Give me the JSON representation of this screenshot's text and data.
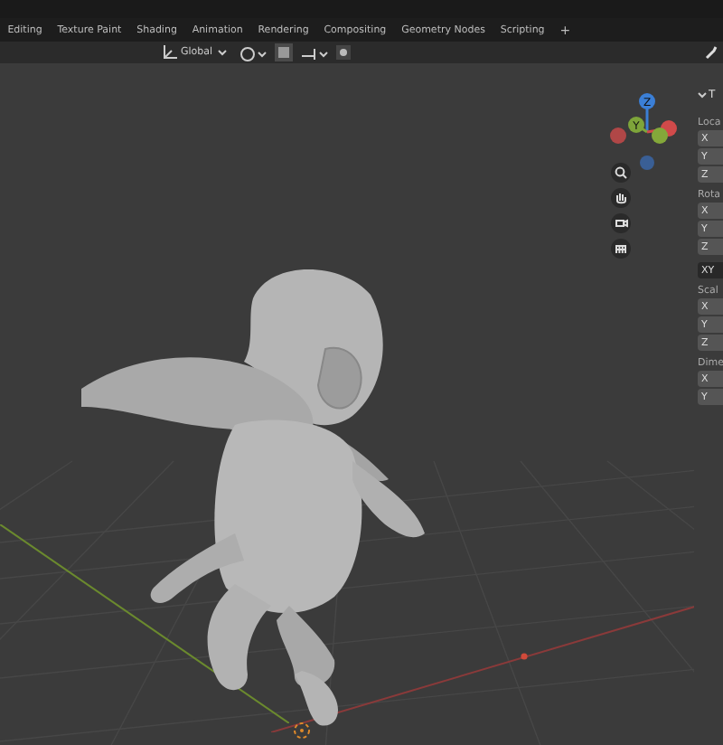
{
  "workspace_tabs": [
    {
      "label": "Editing",
      "selected": false
    },
    {
      "label": "Texture Paint",
      "selected": false
    },
    {
      "label": "Shading",
      "selected": false
    },
    {
      "label": "Animation",
      "selected": false
    },
    {
      "label": "Rendering",
      "selected": false
    },
    {
      "label": "Compositing",
      "selected": false
    },
    {
      "label": "Geometry Nodes",
      "selected": false
    },
    {
      "label": "Scripting",
      "selected": false
    }
  ],
  "add_tab": "+",
  "header": {
    "orientation": "Global",
    "snap_on": true
  },
  "gizmo": {
    "z_label": "Z",
    "y_label": "Y"
  },
  "sidebar": {
    "panel_title": "T",
    "rows": [
      {
        "kind": "label",
        "text": "Loca"
      },
      {
        "kind": "field",
        "text": "X"
      },
      {
        "kind": "field",
        "text": "Y"
      },
      {
        "kind": "field",
        "text": "Z"
      },
      {
        "kind": "label",
        "text": "Rota"
      },
      {
        "kind": "field",
        "text": "X"
      },
      {
        "kind": "field",
        "text": "Y"
      },
      {
        "kind": "field",
        "text": "Z"
      },
      {
        "kind": "dropdown",
        "text": "XY"
      },
      {
        "kind": "label",
        "text": "Scal"
      },
      {
        "kind": "field",
        "text": "X"
      },
      {
        "kind": "field",
        "text": "Y"
      },
      {
        "kind": "field",
        "text": "Z"
      },
      {
        "kind": "label",
        "text": "Dime"
      },
      {
        "kind": "field",
        "text": "X"
      },
      {
        "kind": "field",
        "text": "Y"
      }
    ]
  }
}
